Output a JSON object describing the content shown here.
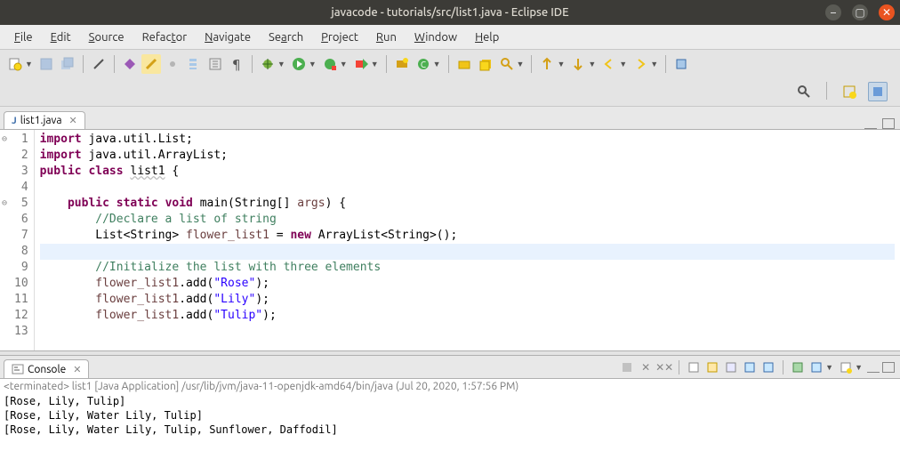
{
  "window": {
    "title": "javacode - tutorials/src/list1.java - Eclipse IDE"
  },
  "menu": {
    "file": "File",
    "edit": "Edit",
    "source": "Source",
    "refactor": "Refactor",
    "navigate": "Navigate",
    "search": "Search",
    "project": "Project",
    "run": "Run",
    "window": "Window",
    "help": "Help"
  },
  "editor_tab": {
    "icon": "J",
    "label": "list1.java"
  },
  "code": {
    "lines": [
      {
        "n": "1",
        "html": "<span class='kw'>import</span> java.util.List;"
      },
      {
        "n": "2",
        "html": "<span class='kw'>import</span> java.util.ArrayList;"
      },
      {
        "n": "3",
        "html": "<span class='kw'>public</span> <span class='kw'>class</span> <span class='dim'>list1</span> {"
      },
      {
        "n": "4",
        "html": ""
      },
      {
        "n": "5",
        "html": "    <span class='kw'>public</span> <span class='kw'>static</span> <span class='kw'>void</span> main(String[] <span class='param'>args</span>) {"
      },
      {
        "n": "6",
        "html": "        <span class='cm'>//Declare a list of string</span>"
      },
      {
        "n": "7",
        "html": "        List&lt;String&gt; <span class='id'>flower_list1</span> = <span class='kw'>new</span> ArrayList&lt;String&gt;();"
      },
      {
        "n": "8",
        "html": "",
        "current": true
      },
      {
        "n": "9",
        "html": "        <span class='cm'>//Initialize the list with three elements</span>"
      },
      {
        "n": "10",
        "html": "        <span class='id'>flower_list1</span>.add(<span class='str'>\"Rose\"</span>);"
      },
      {
        "n": "11",
        "html": "        <span class='id'>flower_list1</span>.add(<span class='str'>\"Lily\"</span>);"
      },
      {
        "n": "12",
        "html": "        <span class='id'>flower_list1</span>.add(<span class='str'>\"Tulip\"</span>);"
      },
      {
        "n": "13",
        "html": ""
      }
    ],
    "fold_lines": [
      "1",
      "5"
    ]
  },
  "console_tab": {
    "label": "Console"
  },
  "console": {
    "header": "<terminated> list1 [Java Application] /usr/lib/jvm/java-11-openjdk-amd64/bin/java (Jul 20, 2020, 1:57:56 PM)",
    "output": [
      "[Rose, Lily, Tulip]",
      "[Rose, Lily, Water Lily, Tulip]",
      "[Rose, Lily, Water Lily, Tulip, Sunflower, Daffodil]"
    ]
  }
}
